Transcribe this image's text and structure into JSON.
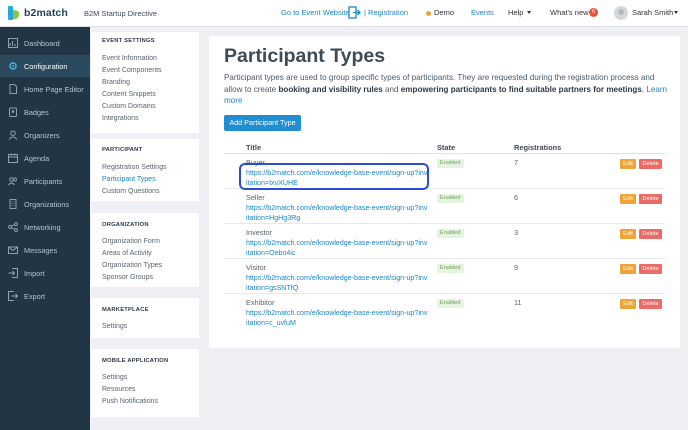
{
  "brand": {
    "name": "b2match",
    "logo_colors": [
      "#29a8e0",
      "#8cc63f"
    ]
  },
  "header": {
    "event_title": "B2M Startup Directive",
    "goto_label": "Go to Event Website",
    "registration_label": "| Registration",
    "demo_label": "Demo",
    "events_label": "Events",
    "help_label": "Help",
    "whats_new_label": "What's new",
    "whats_new_count": "6",
    "user_name": "Sarah Smith"
  },
  "sidebar": {
    "items": [
      {
        "label": "Dashboard",
        "icon": "dashboard-icon"
      },
      {
        "label": "Configuration",
        "icon": "gear-icon",
        "active": true
      },
      {
        "label": "Home Page Editor",
        "icon": "document-icon"
      },
      {
        "label": "Badges",
        "icon": "badge-icon"
      },
      {
        "label": "Organizers",
        "icon": "user-icon"
      },
      {
        "label": "Agenda",
        "icon": "calendar-icon"
      },
      {
        "label": "Participants",
        "icon": "users-icon"
      },
      {
        "label": "Organizations",
        "icon": "building-icon"
      },
      {
        "label": "Networking",
        "icon": "network-icon"
      },
      {
        "label": "Messages",
        "icon": "envelope-icon"
      },
      {
        "label": "Import",
        "icon": "import-icon"
      },
      {
        "label": "Export",
        "icon": "export-icon"
      }
    ]
  },
  "subnav": {
    "sections": [
      {
        "heading": "EVENT SETTINGS",
        "links": [
          "Event Information",
          "Event Components",
          "Branding",
          "Content Snippets",
          "Custom Domains",
          "Integrations"
        ]
      },
      {
        "heading": "PARTICIPANT",
        "links": [
          "Registration Settings",
          "Participant Types",
          "Custom Questions"
        ],
        "active_index": 1
      },
      {
        "heading": "ORGANIZATION",
        "links": [
          "Organization Form",
          "Areas of Activity",
          "Organization Types",
          "Sponsor Groups"
        ]
      },
      {
        "heading": "MARKETPLACE",
        "links": [
          "Settings"
        ]
      },
      {
        "heading": "MOBILE APPLICATION",
        "links": [
          "Settings",
          "Resources",
          "Push Notifications"
        ]
      }
    ]
  },
  "main": {
    "title": "Participant Types",
    "desc_1": "Participant types are used to group specific types of participants. They are requested during the registration process and allow to create ",
    "desc_b1": "booking and visibility rules",
    "desc_2": " and ",
    "desc_b2": "empowering participants to find suitable partners for meetings",
    "desc_3": ". ",
    "learn_more": "Learn more",
    "add_button": "Add Participant Type",
    "columns": {
      "title": "Title",
      "state": "State",
      "registrations": "Registrations"
    },
    "edit_label": "Edit",
    "delete_label": "Delete",
    "rows": [
      {
        "title": "Buyer",
        "link": "https://b2match.com/e/knowledge-base-event/sign-up?invitation=IxvXUHE",
        "state": "Enabled",
        "registrations": "7"
      },
      {
        "title": "Seller",
        "link": "https://b2match.com/e/knowledge-base-event/sign-up?invitation=HgHg3Rg",
        "state": "Enabled",
        "registrations": "6"
      },
      {
        "title": "Investor",
        "link": "https://b2match.com/e/knowledge-base-event/sign-up?invitation=Oebo4ic",
        "state": "Enabled",
        "registrations": "3"
      },
      {
        "title": "Visitor",
        "link": "https://b2match.com/e/knowledge-base-event/sign-up?invitation=gsSNTfQ",
        "state": "Enabled",
        "registrations": "9"
      },
      {
        "title": "Exhibitor",
        "link": "https://b2match.com/e/knowledge-base-event/sign-up?invitation=c_uvfuM",
        "state": "Enabled",
        "registrations": "11"
      }
    ]
  },
  "colors": {
    "sidebar_bg": "#213544",
    "accent": "#1a86c7",
    "edit": "#f0a437",
    "delete": "#ec6b67",
    "highlight": "#2d4bd8"
  }
}
